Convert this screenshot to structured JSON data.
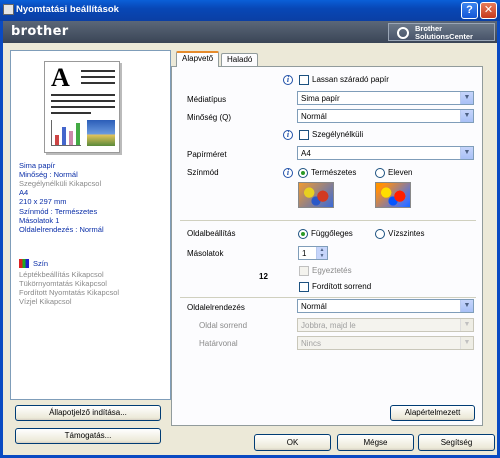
{
  "window": {
    "title": "Nyomtatási beállítások",
    "help_label": "?",
    "close_label": "✕"
  },
  "brand": {
    "logo": "brother",
    "solutions_line1": "Brother",
    "solutions_line2": "SolutionsCenter",
    "solutions_icon": "circle-icon"
  },
  "preview": {
    "letter": "A"
  },
  "summary": {
    "media": "Sima papír",
    "quality": "Minőség : Normál",
    "borderless": "Szegélynélküli Kikapcsol",
    "size": "A4",
    "dims": "210 x 297 mm",
    "color_mode": "Színmód : Természetes",
    "copies": "Másolatok 1",
    "layout": "Oldalelrendezés : Normál"
  },
  "extras": {
    "color": "Szín",
    "scaling": "Léptékbeállítás Kikapcsol",
    "mirror": "Tükörnyomtatás Kikapcsol",
    "reverse": "Fordított Nyomtatás Kikapcsol",
    "watermark": "Vízjel Kikapcsol"
  },
  "buttons": {
    "status_monitor": "Állapotjelző indítása...",
    "support": "Támogatás...",
    "default": "Alapértelmezett",
    "ok": "OK",
    "cancel": "Mégse",
    "help": "Segítség"
  },
  "tabs": {
    "basic": "Alapvető",
    "advanced": "Haladó"
  },
  "basic": {
    "slow_dry": "Lassan száradó papír",
    "media_label": "Médiatípus",
    "media_value": "Sima papír",
    "quality_label": "Minőség (Q)",
    "quality_value": "Normál",
    "borderless": "Szegélynélküli",
    "paper_size_label": "Papírméret",
    "paper_size_value": "A4",
    "color_mode_label": "Színmód",
    "color_natural": "Természetes",
    "color_vivid": "Eleven",
    "orientation_label": "Oldalbeállítás",
    "portrait": "Függőleges",
    "landscape": "Vízszintes",
    "copies_label": "Másolatok",
    "copies_value": "1",
    "collate": "Egyeztetés",
    "reverse_order": "Fordított sorrend",
    "collate_icon_text": "12",
    "layout_label": "Oldalelrendezés",
    "layout_value": "Normál",
    "page_order_label": "Oldal sorrend",
    "page_order_value": "Jobbra, majd le",
    "border_label": "Határvonal",
    "border_value": "Nincs"
  }
}
